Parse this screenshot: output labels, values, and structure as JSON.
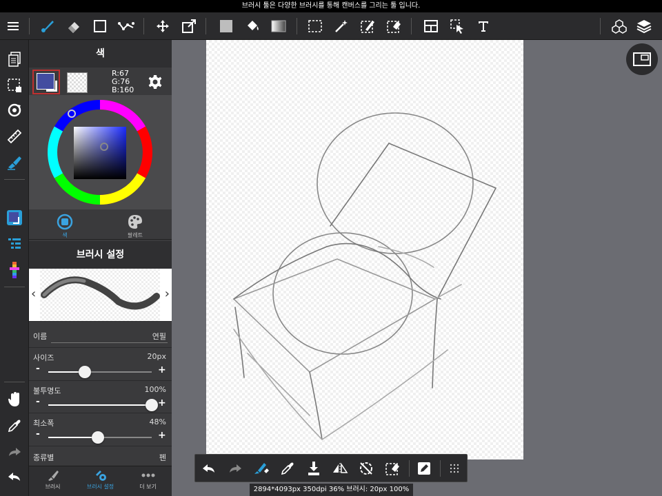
{
  "tip": "브러시 툴은 다양한 브러시를 통해 캔버스를 그리는 툴 입니다.",
  "panel": {
    "color_title": "색",
    "rgb": {
      "r": "R:67",
      "g": "G:76",
      "b": "B:160"
    },
    "fg_color": "#434CA0",
    "tabs": [
      {
        "label": "색"
      },
      {
        "label": "팔레트"
      }
    ],
    "brush_title": "브러시 설정",
    "props": {
      "name_label": "이름",
      "name_value": "연필",
      "size_label": "사이즈",
      "size_value": "20px",
      "size_fraction": 0.35,
      "opacity_label": "불투명도",
      "opacity_value": "100%",
      "opacity_fraction": 1.0,
      "minwidth_label": "최소폭",
      "minwidth_value": "48%",
      "minwidth_fraction": 0.48,
      "type_label": "종류별",
      "type_value": "펜"
    },
    "bottom_tabs": [
      {
        "label": "브러시"
      },
      {
        "label": "브러시 설정"
      },
      {
        "label": "더 보기"
      }
    ]
  },
  "status": "2894*4093px 350dpi 36% 브러시: 20px 100%",
  "colors": {
    "accent": "#2a9fd8",
    "active_tab": "#3aa3e0"
  }
}
